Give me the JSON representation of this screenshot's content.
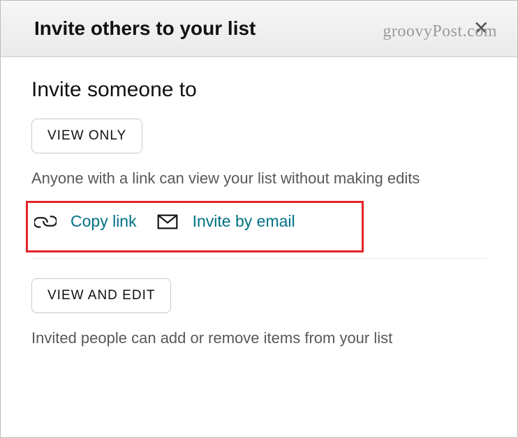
{
  "watermark": "groovyPost.com",
  "header": {
    "title": "Invite others to your list"
  },
  "section": {
    "title": "Invite someone to"
  },
  "viewOnly": {
    "buttonLabel": "VIEW ONLY",
    "description": "Anyone with a link can view your list without making edits",
    "actions": {
      "copyLink": "Copy link",
      "inviteByEmail": "Invite by email"
    }
  },
  "viewAndEdit": {
    "buttonLabel": "VIEW AND EDIT",
    "description": "Invited people can add or remove items from your list"
  }
}
